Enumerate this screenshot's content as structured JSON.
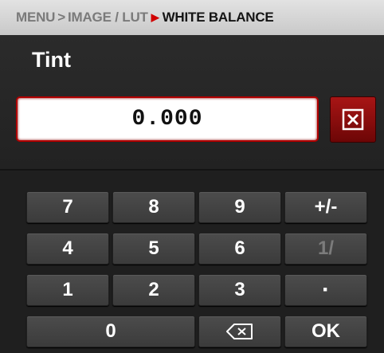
{
  "breadcrumb": {
    "items": [
      "MENU",
      "IMAGE / LUT",
      "WHITE BALANCE"
    ],
    "separator": ">"
  },
  "title": "Tint",
  "value_field": {
    "value": "0.000"
  },
  "clear_button": {
    "icon": "close-box-icon"
  },
  "keypad": {
    "keys": [
      "7",
      "8",
      "9",
      "+/-",
      "4",
      "5",
      "6",
      "1/",
      "1",
      "2",
      "3",
      "·",
      "0",
      "⌫",
      "OK"
    ],
    "disabled": [
      "1/"
    ]
  },
  "colors": {
    "accent_red": "#b00000",
    "panel": "#262626",
    "key": "#444444"
  }
}
